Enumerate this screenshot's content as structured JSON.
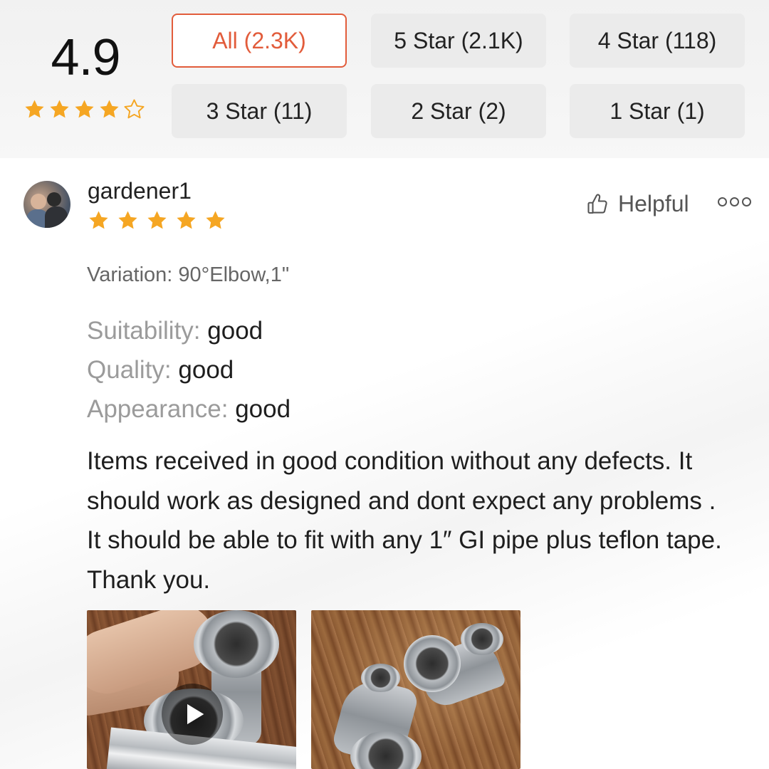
{
  "summary": {
    "score": "4.9",
    "rating": 4.5,
    "max_rating": 5
  },
  "filters": [
    {
      "label": "All (2.3K)",
      "active": true
    },
    {
      "label": "5 Star (2.1K)",
      "active": false
    },
    {
      "label": "4 Star (118)",
      "active": false
    },
    {
      "label": "3 Star (11)",
      "active": false
    },
    {
      "label": "2 Star (2)",
      "active": false
    },
    {
      "label": "1 Star (1)",
      "active": false
    }
  ],
  "review": {
    "username": "gardener1",
    "rating": 5,
    "helpful_label": "Helpful",
    "more_icon": "more-options-icon",
    "variation": "Variation: 90°Elbow,1\"",
    "attributes": [
      {
        "key": "Suitability:",
        "value": "good"
      },
      {
        "key": "Quality:",
        "value": "good"
      },
      {
        "key": "Appearance:",
        "value": "good"
      }
    ],
    "text": "Items received in good condition without any defects. It should work as designed and dont expect any problems . It should be able to fit with any 1″ GI pipe plus teflon tape. Thank you.",
    "media": [
      {
        "type": "video",
        "icon": "play-icon"
      },
      {
        "type": "image"
      }
    ]
  },
  "colors": {
    "accent": "#e25c3b",
    "star": "#f5a623",
    "star_empty_stroke": "#f5a623"
  }
}
